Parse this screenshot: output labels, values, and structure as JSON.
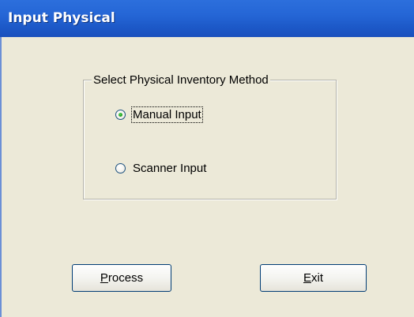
{
  "window": {
    "title": "Input Physical"
  },
  "group": {
    "label": "Select Physical Inventory Method",
    "options": [
      {
        "label": "Manual Input",
        "checked": true
      },
      {
        "label": "Scanner Input",
        "checked": false
      }
    ]
  },
  "buttons": {
    "process_label": "Process",
    "exit_label": "Exit"
  },
  "colors": {
    "titlebar": "#2566d6",
    "window_bg": "#ece9d8",
    "radio_dot": "#21a121"
  }
}
